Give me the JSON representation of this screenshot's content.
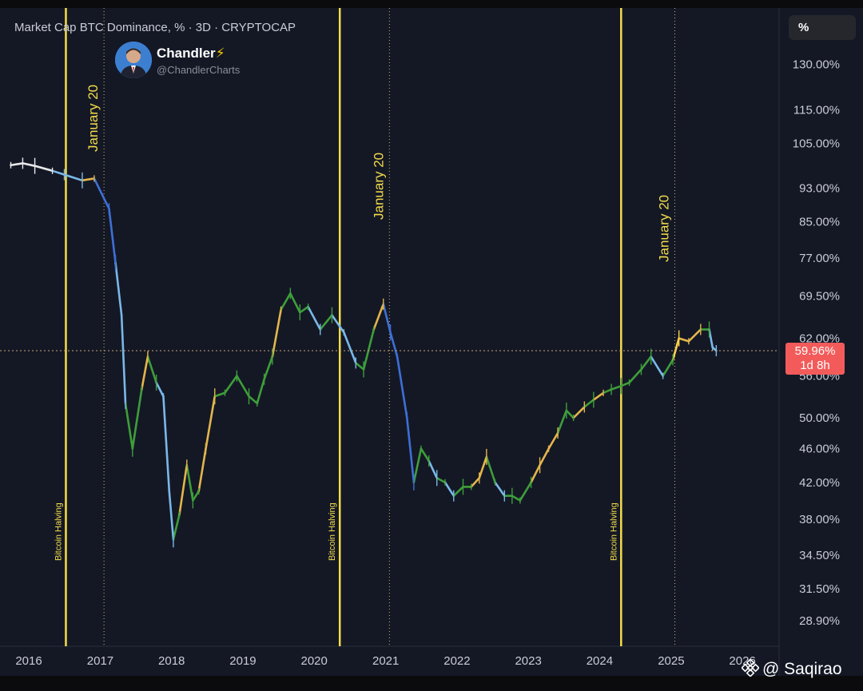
{
  "chart_title": "Market Cap BTC Dominance, % · 3D · CRYPTOCAP",
  "unit_button_label": "%",
  "author": {
    "name": "Chandler",
    "bolt": "⚡",
    "handle": "@ChandlerCharts"
  },
  "watermark": "@ Saqirao",
  "current_value": {
    "price": "59.96%",
    "countdown": "1d 8h"
  },
  "colors": {
    "background": "#141825",
    "frame": "#0b0b0d",
    "grid": "#2a2e3c",
    "event_line": "#f3dc4a",
    "price_badge": "#f35b5b",
    "candle_palette": [
      "#e9e9e9",
      "#7ab8e8",
      "#3e6fd6",
      "#3e9e3a",
      "#e3b64b",
      "#ffd24a"
    ]
  },
  "chart_data": {
    "type": "line",
    "title": "Market Cap BTC Dominance, % · 3D · CRYPTOCAP",
    "xlabel": "",
    "ylabel": "",
    "x_ticks": [
      "2016",
      "2017",
      "2018",
      "2019",
      "2020",
      "2021",
      "2022",
      "2023",
      "2024",
      "2025",
      "2026"
    ],
    "y_ticks": [
      "130.00%",
      "115.00%",
      "105.00%",
      "93.00%",
      "85.00%",
      "77.00%",
      "69.50%",
      "62.00%",
      "56.00%",
      "50.00%",
      "46.00%",
      "42.00%",
      "38.00%",
      "34.50%",
      "31.50%",
      "28.90%"
    ],
    "ylim": [
      27.5,
      145
    ],
    "y_scale": "log",
    "grid": false,
    "current_value": 59.96,
    "event_lines": [
      {
        "label": "Bitcoin Halving",
        "date": "2016-07-09",
        "style": "solid"
      },
      {
        "label": "January 20",
        "date": "2017-01-20",
        "style": "dotted"
      },
      {
        "label": "Bitcoin Halving",
        "date": "2020-05-11",
        "style": "solid"
      },
      {
        "label": "January 20",
        "date": "2021-01-20",
        "style": "dotted"
      },
      {
        "label": "Bitcoin Halving",
        "date": "2024-04-20",
        "style": "solid"
      },
      {
        "label": "January 20",
        "date": "2025-01-20",
        "style": "dotted"
      }
    ],
    "series": [
      {
        "points": [
          [
            "2015-10-01",
            99.0,
            0
          ],
          [
            "2015-12-01",
            99.5,
            0
          ],
          [
            "2016-02-01",
            98.8,
            0
          ],
          [
            "2016-05-01",
            97.5,
            0
          ],
          [
            "2016-07-01",
            96.5,
            1
          ],
          [
            "2016-10-01",
            95.0,
            1
          ],
          [
            "2016-12-01",
            95.5,
            4
          ],
          [
            "2017-02-15",
            88.0,
            2
          ],
          [
            "2017-03-20",
            76.0,
            2
          ],
          [
            "2017-04-20",
            66.0,
            1
          ],
          [
            "2017-05-10",
            52.0,
            1
          ],
          [
            "2017-06-15",
            46.0,
            3
          ],
          [
            "2017-08-01",
            54.0,
            3
          ],
          [
            "2017-09-01",
            59.0,
            4
          ],
          [
            "2017-10-15",
            55.0,
            3
          ],
          [
            "2017-11-20",
            53.0,
            1
          ],
          [
            "2017-12-20",
            41.0,
            1
          ],
          [
            "2018-01-10",
            36.0,
            1
          ],
          [
            "2018-02-10",
            38.5,
            3
          ],
          [
            "2018-03-20",
            44.0,
            4
          ],
          [
            "2018-04-20",
            40.0,
            3
          ],
          [
            "2018-05-20",
            41.0,
            3
          ],
          [
            "2018-06-25",
            46.0,
            4
          ],
          [
            "2018-08-10",
            53.0,
            4
          ],
          [
            "2018-10-01",
            53.5,
            3
          ],
          [
            "2018-12-01",
            56.0,
            3
          ],
          [
            "2019-02-01",
            53.0,
            3
          ],
          [
            "2019-03-15",
            52.0,
            3
          ],
          [
            "2019-04-20",
            55.5,
            3
          ],
          [
            "2019-06-01",
            59.0,
            3
          ],
          [
            "2019-07-15",
            67.0,
            4
          ],
          [
            "2019-09-01",
            70.0,
            3
          ],
          [
            "2019-10-20",
            66.5,
            3
          ],
          [
            "2019-12-01",
            67.5,
            3
          ],
          [
            "2020-02-01",
            63.5,
            1
          ],
          [
            "2020-04-01",
            66.0,
            3
          ],
          [
            "2020-06-01",
            63.0,
            1
          ],
          [
            "2020-08-01",
            58.0,
            1
          ],
          [
            "2020-09-10",
            57.0,
            3
          ],
          [
            "2020-11-01",
            63.5,
            3
          ],
          [
            "2020-12-20",
            68.0,
            4
          ],
          [
            "2021-01-25",
            63.0,
            2
          ],
          [
            "2021-03-01",
            59.0,
            2
          ],
          [
            "2021-04-20",
            50.0,
            2
          ],
          [
            "2021-05-25",
            42.0,
            2
          ],
          [
            "2021-07-01",
            46.0,
            3
          ],
          [
            "2021-08-10",
            44.5,
            3
          ],
          [
            "2021-09-20",
            42.5,
            1
          ],
          [
            "2021-11-01",
            42.0,
            3
          ],
          [
            "2021-12-15",
            40.5,
            1
          ],
          [
            "2022-02-01",
            41.5,
            3
          ],
          [
            "2022-03-15",
            41.5,
            3
          ],
          [
            "2022-04-25",
            42.5,
            4
          ],
          [
            "2022-06-01",
            45.0,
            4
          ],
          [
            "2022-07-15",
            42.0,
            3
          ],
          [
            "2022-09-01",
            40.5,
            1
          ],
          [
            "2022-10-10",
            40.5,
            3
          ],
          [
            "2022-11-20",
            40.0,
            3
          ],
          [
            "2023-01-15",
            42.0,
            3
          ],
          [
            "2023-03-01",
            44.0,
            4
          ],
          [
            "2023-04-15",
            46.0,
            4
          ],
          [
            "2023-06-01",
            48.0,
            4
          ],
          [
            "2023-07-15",
            51.0,
            3
          ],
          [
            "2023-08-20",
            50.0,
            3
          ],
          [
            "2023-10-15",
            51.5,
            4
          ],
          [
            "2023-12-01",
            52.5,
            3
          ],
          [
            "2024-01-20",
            53.5,
            4
          ],
          [
            "2024-03-01",
            54.0,
            3
          ],
          [
            "2024-04-20",
            54.5,
            3
          ],
          [
            "2024-06-01",
            55.0,
            3
          ],
          [
            "2024-08-01",
            57.0,
            3
          ],
          [
            "2024-09-20",
            59.0,
            3
          ],
          [
            "2024-11-20",
            56.0,
            1
          ],
          [
            "2025-01-10",
            58.5,
            3
          ],
          [
            "2025-02-10",
            62.0,
            5
          ],
          [
            "2025-04-01",
            61.5,
            4
          ],
          [
            "2025-06-01",
            63.5,
            4
          ],
          [
            "2025-07-15",
            63.5,
            3
          ],
          [
            "2025-08-01",
            60.5,
            1
          ],
          [
            "2025-08-20",
            59.96,
            1
          ]
        ]
      }
    ]
  }
}
